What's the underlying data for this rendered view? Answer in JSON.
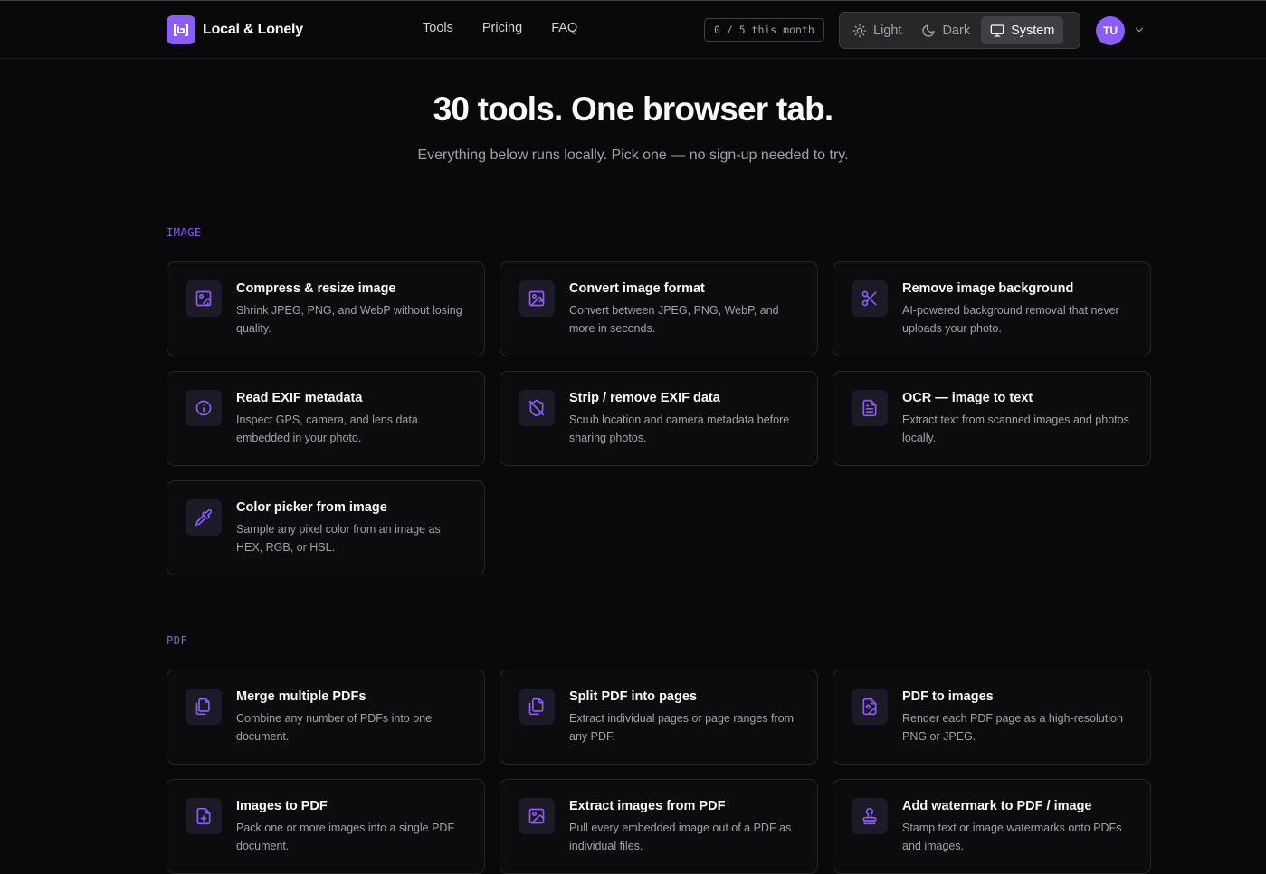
{
  "app": {
    "name": "Local & Lonely"
  },
  "nav": {
    "items": [
      "Tools",
      "Pricing",
      "FAQ"
    ]
  },
  "quota": {
    "text": "0 / 5 this month"
  },
  "theme": {
    "options": [
      "Light",
      "Dark",
      "System"
    ],
    "selected": "System"
  },
  "user": {
    "initials": "TU"
  },
  "colors": {
    "accent": "#8b5cf6",
    "background": "#09090b"
  },
  "hero": {
    "title": "30 tools. One browser tab.",
    "subtitle": "Everything below runs locally. Pick one — no sign-up needed to try."
  },
  "sections": [
    {
      "label": "IMAGE",
      "tools": [
        {
          "title": "Compress & resize image",
          "desc": "Shrink JPEG, PNG, and WebP without losing quality.",
          "icon": "image-compress-icon"
        },
        {
          "title": "Convert image format",
          "desc": "Convert between JPEG, PNG, WebP, and more in seconds.",
          "icon": "image-convert-icon"
        },
        {
          "title": "Remove image background",
          "desc": "AI-powered background removal that never uploads your photo.",
          "icon": "scissors-icon"
        },
        {
          "title": "Read EXIF metadata",
          "desc": "Inspect GPS, camera, and lens data embedded in your photo.",
          "icon": "info-icon"
        },
        {
          "title": "Strip / remove EXIF data",
          "desc": "Scrub location and camera metadata before sharing photos.",
          "icon": "shield-off-icon"
        },
        {
          "title": "OCR — image to text",
          "desc": "Extract text from scanned images and photos locally.",
          "icon": "file-text-icon"
        },
        {
          "title": "Color picker from image",
          "desc": "Sample any pixel color from an image as HEX, RGB, or HSL.",
          "icon": "pipette-icon"
        }
      ]
    },
    {
      "label": "PDF",
      "tools": [
        {
          "title": "Merge multiple PDFs",
          "desc": "Combine any number of PDFs into one document.",
          "icon": "files-icon"
        },
        {
          "title": "Split PDF into pages",
          "desc": "Extract individual pages or page ranges from any PDF.",
          "icon": "split-pages-icon"
        },
        {
          "title": "PDF to images",
          "desc": "Render each PDF page as a high-resolution PNG or JPEG.",
          "icon": "file-image-icon"
        },
        {
          "title": "Images to PDF",
          "desc": "Pack one or more images into a single PDF document.",
          "icon": "file-plus-icon"
        },
        {
          "title": "Extract images from PDF",
          "desc": "Pull every embedded image out of a PDF as individual files.",
          "icon": "image-icon"
        },
        {
          "title": "Add watermark to PDF / image",
          "desc": "Stamp text or image watermarks onto PDFs and images.",
          "icon": "stamp-icon"
        }
      ]
    }
  ]
}
